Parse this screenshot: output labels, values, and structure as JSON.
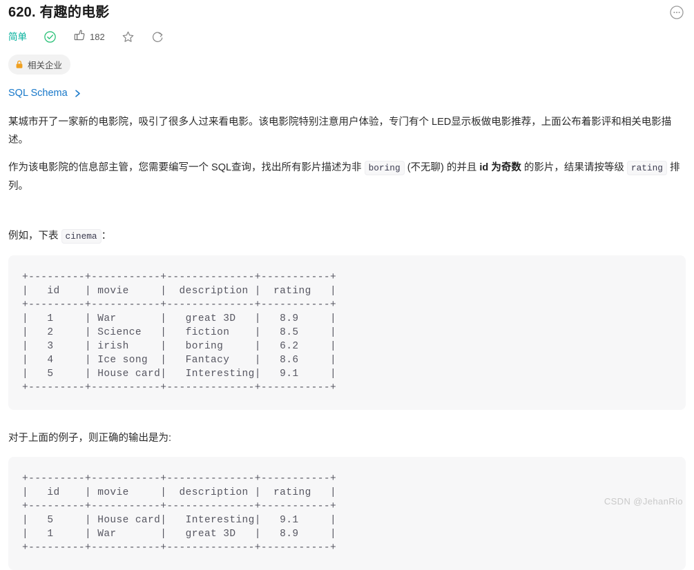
{
  "header": {
    "title": "620. 有趣的电影",
    "more_icon": "more-horizontal-circle-icon"
  },
  "meta": {
    "difficulty": "简单",
    "solved_icon": "check-circle-icon",
    "like_icon": "thumbs-up-icon",
    "like_count": "182",
    "favorite_icon": "star-icon",
    "reset_icon": "refresh-icon"
  },
  "tags": {
    "company": {
      "label": "相关企业",
      "lock_icon": "lock-icon",
      "lock_color": "#f0a020"
    }
  },
  "schema": {
    "label": "SQL Schema",
    "chevron_icon": "chevron-right-icon",
    "link_color": "#1677c9"
  },
  "content": {
    "paragraph_1": "某城市开了一家新的电影院，吸引了很多人过来看电影。该电影院特别注意用户体验，专门有个 LED显示板做电影推荐，上面公布着影评和相关电影描述。",
    "paragraph_2": {
      "part_1": "作为该电影院的信息部主管，您需要编写一个 SQL查询，找出所有影片描述为非",
      "code_1": "boring",
      "part_2": "(不无聊) 的并且",
      "bold_1": "id 为奇数",
      "part_3": "的影片，结果请按等级",
      "code_2": "rating",
      "part_4": "排列。"
    },
    "paragraph_3": {
      "part_1": "例如，下表",
      "code_1": "cinema",
      "part_2": "："
    },
    "paragraph_4": "对于上面的例子，则正确的输出是为:"
  },
  "tables": {
    "cinema": "+---------+-----------+--------------+-----------+\n|   id    | movie     |  description |  rating   |\n+---------+-----------+--------------+-----------+\n|   1     | War       |   great 3D   |   8.9     |\n|   2     | Science   |   fiction    |   8.5     |\n|   3     | irish     |   boring     |   6.2     |\n|   4     | Ice song  |   Fantacy    |   8.6     |\n|   5     | House card|   Interesting|   9.1     |\n+---------+-----------+--------------+-----------+",
    "output": "+---------+-----------+--------------+-----------+\n|   id    | movie     |  description |  rating   |\n+---------+-----------+--------------+-----------+\n|   5     | House card|   Interesting|   9.1     |\n|   1     | War       |   great 3D   |   8.9     |\n+---------+-----------+--------------+-----------+"
  },
  "watermark": "CSDN @JehanRio"
}
